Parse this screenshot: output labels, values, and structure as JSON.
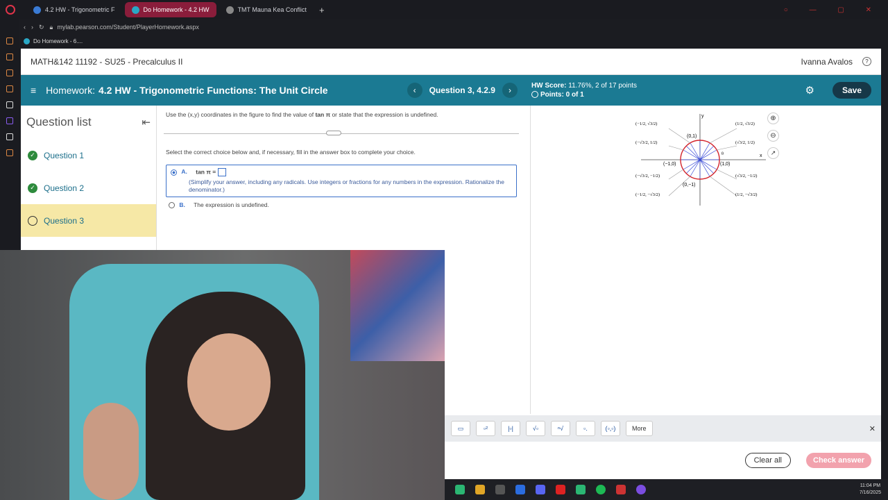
{
  "browser": {
    "tabs": [
      {
        "label": "4.2 HW - Trigonometric F"
      },
      {
        "label": "Do Homework - 4.2 HW"
      },
      {
        "label": "TMT Mauna Kea Conflict"
      }
    ],
    "url": "mylab.pearson.com/Student/PlayerHomework.aspx",
    "bookmark": "Do Homework - 6...."
  },
  "course": {
    "title": "MATH&142 11192 - SU25 - Precalculus II",
    "user": "Ivanna Avalos"
  },
  "homework": {
    "prefix": "Homework:",
    "title": "4.2 HW - Trigonometric Functions: The Unit Circle",
    "question": "Question 3, 4.2.9",
    "score_label": "HW Score:",
    "score_value": "11.76%, 2 of 17 points",
    "points": "Points: 0 of 1",
    "save": "Save"
  },
  "question_list": {
    "title": "Question list",
    "items": [
      {
        "label": "Question 1",
        "status": "complete"
      },
      {
        "label": "Question 2",
        "status": "complete"
      },
      {
        "label": "Question 3",
        "status": "current"
      }
    ]
  },
  "problem": {
    "instruction_pre": "Use the (x,y) coordinates in the figure to find the value of ",
    "instruction_expr": "tan π",
    "instruction_post": " or state that the expression is undefined.",
    "select_text": "Select the correct choice below and, if necessary, fill in the answer box to complete your choice.",
    "option_a_letter": "A.",
    "option_a_expr": "tan π =",
    "option_a_hint": "(Simplify your answer, including any radicals. Use integers or fractions for any numbers in the expression. Rationalize the denominator.)",
    "option_b_letter": "B.",
    "option_b_text": "The expression is undefined."
  },
  "figure": {
    "axis_x": "x",
    "axis_y": "y",
    "labels": [
      "(0,1)",
      "(−1,0)",
      "(1,0)",
      "(0,−1)"
    ],
    "fractions_left": [
      "(−1/2, √3/2)",
      "(−√3/2, 1/2)",
      "(−√3/2, −1/2)",
      "(−1/2, −√3/2)"
    ],
    "fractions_right": [
      "(1/2, √3/2)",
      "(√3/2, 1/2)",
      "(√3/2, −1/2)",
      "(1/2, −√3/2)"
    ],
    "theta": "θ"
  },
  "toolbar": {
    "more": "More"
  },
  "footer": {
    "clear": "Clear all",
    "check": "Check answer"
  },
  "taskbar": {
    "time": "11:04 PM",
    "date": "7/16/2025"
  }
}
